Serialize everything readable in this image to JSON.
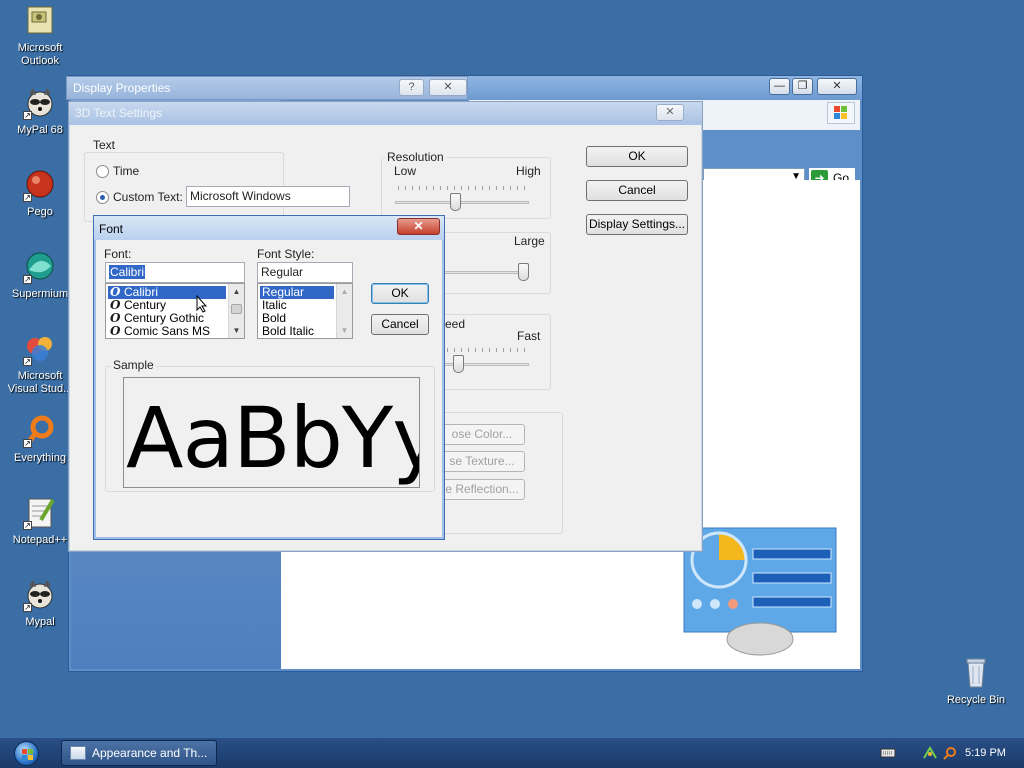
{
  "desktop": {
    "icons": [
      {
        "label": "Microsoft Outlook",
        "icon": "outlook-icon"
      },
      {
        "label": "MyPal 68",
        "icon": "mypal-icon"
      },
      {
        "label": "Pego",
        "icon": "pego-icon"
      },
      {
        "label": "Supermium",
        "icon": "supermium-icon"
      },
      {
        "label": "Microsoft Visual Stud...",
        "icon": "visual-studio-icon"
      },
      {
        "label": "Everything",
        "icon": "everything-icon"
      },
      {
        "label": "Notepad++",
        "icon": "notepad-plus-plus-icon"
      },
      {
        "label": "Mypal",
        "icon": "mypal-icon"
      },
      {
        "label": "Recycle Bin",
        "icon": "recycle-bin-icon"
      }
    ]
  },
  "explorer": {
    "go_label": "Go"
  },
  "display_properties": {
    "title": "Display Properties"
  },
  "settings_dialog": {
    "title": "3D Text Settings",
    "text_group": "Text",
    "radio_time": "Time",
    "radio_custom": "Custom Text:",
    "custom_text_value": "Microsoft Windows",
    "resolution_group": "Resolution",
    "resolution_low": "Low",
    "resolution_high": "High",
    "size_large": "Large",
    "speed_group_partial": "eed",
    "speed_fast": "Fast",
    "choose_color": "ose Color...",
    "choose_texture": "se Texture...",
    "choose_reflection": "e Reflection...",
    "ok": "OK",
    "cancel": "Cancel",
    "display_settings": "Display Settings..."
  },
  "font_dialog": {
    "title": "Font",
    "font_label": "Font:",
    "font_value": "Calibri",
    "fonts": [
      "Calibri",
      "Century",
      "Century Gothic",
      "Comic Sans MS"
    ],
    "style_label": "Font Style:",
    "style_value": "Regular",
    "styles": [
      "Regular",
      "Italic",
      "Bold",
      "Bold Italic"
    ],
    "ok": "OK",
    "cancel": "Cancel",
    "sample_label": "Sample",
    "sample_text": "AaBbYy"
  },
  "taskbar": {
    "task_label": "Appearance and Th...",
    "clock": "5:19 PM"
  },
  "colors": {
    "desktop": "#3a6ea5",
    "selection": "#3168c8",
    "close_red": "#c4402d"
  }
}
